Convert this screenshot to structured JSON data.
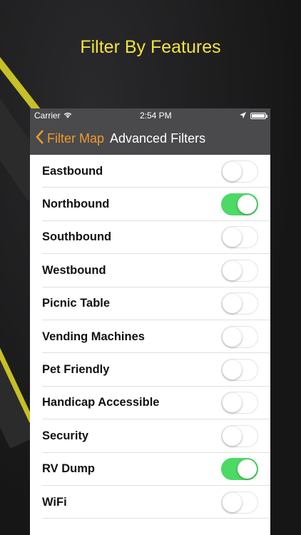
{
  "headline": "Filter By Features",
  "status_bar": {
    "carrier": "Carrier",
    "time": "2:54 PM"
  },
  "nav": {
    "back_label": "Filter Map",
    "title": "Advanced Filters"
  },
  "colors": {
    "accent": "#f09a2c",
    "toggle_on": "#4cd964",
    "headline": "#f2e43a",
    "navbar": "#4a4a4c"
  },
  "filters": [
    {
      "label": "Eastbound",
      "on": false
    },
    {
      "label": "Northbound",
      "on": true
    },
    {
      "label": "Southbound",
      "on": false
    },
    {
      "label": "Westbound",
      "on": false
    },
    {
      "label": "Picnic Table",
      "on": false
    },
    {
      "label": "Vending Machines",
      "on": false
    },
    {
      "label": "Pet Friendly",
      "on": false
    },
    {
      "label": "Handicap Accessible",
      "on": false
    },
    {
      "label": "Security",
      "on": false
    },
    {
      "label": "RV Dump",
      "on": true
    },
    {
      "label": "WiFi",
      "on": false
    }
  ]
}
